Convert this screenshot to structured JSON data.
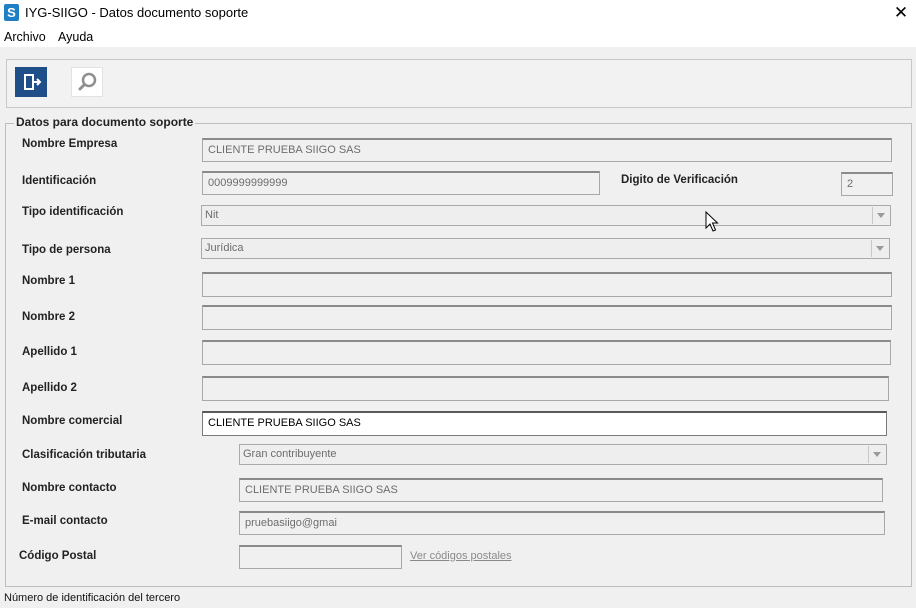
{
  "window": {
    "title": "IYG-SIIGO - Datos documento soporte",
    "app_icon_letter": "S",
    "close_glyph": "✕"
  },
  "menu": {
    "items": [
      "Archivo",
      "Ayuda"
    ]
  },
  "toolbar": {
    "exit_icon": "exit-door-icon",
    "search_icon": "magnifier-icon"
  },
  "group": {
    "legend": "Datos para documento soporte"
  },
  "form": {
    "nombre_empresa": {
      "label": "Nombre Empresa",
      "value": "CLIENTE PRUEBA SIIGO SAS"
    },
    "identificacion": {
      "label": "Identificación",
      "value": "0009999999999"
    },
    "digito": {
      "label": "Digito de Verificación",
      "value": "2"
    },
    "tipo_identificacion": {
      "label": "Tipo identificación",
      "value": "Nit"
    },
    "tipo_persona": {
      "label": "Tipo de persona",
      "value": "Jurídica"
    },
    "nombre1": {
      "label": "Nombre 1",
      "value": ""
    },
    "nombre2": {
      "label": "Nombre 2",
      "value": ""
    },
    "apellido1": {
      "label": "Apellido 1",
      "value": ""
    },
    "apellido2": {
      "label": "Apellido 2",
      "value": ""
    },
    "nombre_comercial": {
      "label": "Nombre comercial",
      "value": "CLIENTE PRUEBA SIIGO SAS"
    },
    "clasificacion_tributaria": {
      "label": "Clasificación tributaria",
      "value": "Gran contribuyente"
    },
    "nombre_contacto": {
      "label": "Nombre contacto",
      "value": "CLIENTE PRUEBA SIIGO SAS"
    },
    "email_contacto": {
      "label": "E-mail contacto",
      "value": "pruebasiigo@gmai"
    },
    "codigo_postal": {
      "label": "Código Postal",
      "value": "",
      "link": "Ver códigos postales"
    }
  },
  "status_bar": {
    "text": "Número de identificación del tercero"
  }
}
